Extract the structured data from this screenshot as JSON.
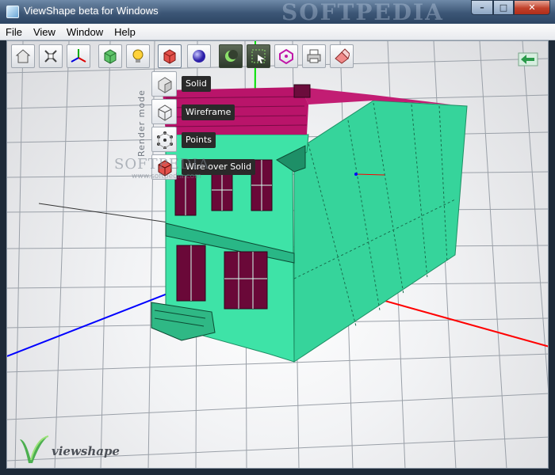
{
  "window": {
    "title": "ViewShape beta for Windows",
    "watermark": "SOFTPEDIA",
    "controls": {
      "minimize": "–",
      "maximize": "□",
      "close": "✕"
    }
  },
  "menu": [
    "File",
    "View",
    "Window",
    "Help"
  ],
  "toolbar": {
    "buttons": [
      {
        "name": "home-view",
        "icon": "house-icon"
      },
      {
        "name": "fit-view",
        "icon": "fit-arrows-icon"
      },
      {
        "name": "axes",
        "icon": "axes-icon"
      },
      {
        "name": "bounding-box",
        "icon": "green-box-icon"
      },
      {
        "name": "lighting",
        "icon": "bulb-icon"
      },
      {
        "name": "render-mode",
        "icon": "red-cube-icon"
      },
      {
        "name": "material",
        "icon": "sphere-icon"
      },
      {
        "name": "shadow",
        "icon": "moon-icon"
      },
      {
        "name": "selection",
        "icon": "select-box-icon"
      },
      {
        "name": "transform",
        "icon": "pink-gizmo-icon"
      },
      {
        "name": "print",
        "icon": "printer-icon"
      },
      {
        "name": "erase",
        "icon": "eraser-icon"
      }
    ]
  },
  "render_mode": {
    "caption": "Render mode",
    "options": [
      {
        "label": "Solid",
        "icon": "solid-cube-icon"
      },
      {
        "label": "Wireframe",
        "icon": "wireframe-cube-icon"
      },
      {
        "label": "Points",
        "icon": "points-cube-icon"
      },
      {
        "label": "Wire over Solid",
        "icon": "wire-solid-cube-icon"
      }
    ]
  },
  "watermark_mid": {
    "text": "SOFTPEDIA",
    "url": "www.softpedia.com"
  },
  "logo": {
    "text": "viewshape"
  },
  "colors": {
    "model": "#3ee3a7",
    "model_dark": "#22a777",
    "roof": "#b9146a",
    "axis_x": "#ff0000",
    "axis_y": "#00e000",
    "axis_z": "#0000ff"
  }
}
